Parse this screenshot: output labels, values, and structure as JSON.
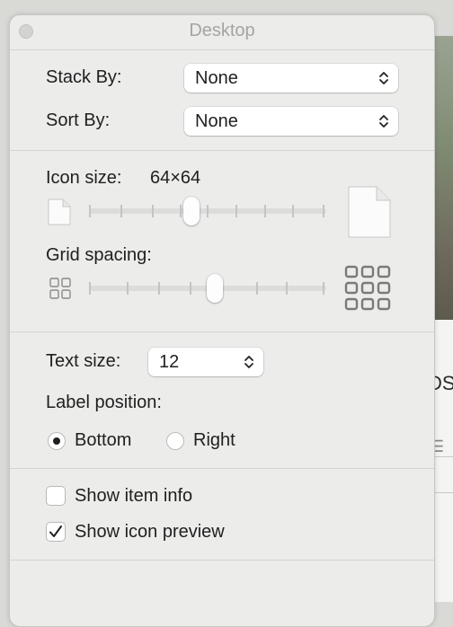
{
  "window": {
    "title": "Desktop"
  },
  "arrange": {
    "stack_by": {
      "label": "Stack By:",
      "value": "None"
    },
    "sort_by": {
      "label": "Sort By:",
      "value": "None"
    }
  },
  "icon_size": {
    "label": "Icon size:",
    "value": "64×64",
    "slider_fraction": 0.43
  },
  "grid_spacing": {
    "label": "Grid spacing:",
    "slider_fraction": 0.53
  },
  "text": {
    "label": "Text size:",
    "value": "12",
    "label_position": {
      "label": "Label position:",
      "options": [
        {
          "label": "Bottom",
          "selected": true
        },
        {
          "label": "Right",
          "selected": false
        }
      ]
    }
  },
  "options": {
    "show_item_info": {
      "label": "Show item info",
      "checked": false
    },
    "show_icon_preview": {
      "label": "Show icon preview",
      "checked": true
    }
  },
  "background": {
    "partial_text": "DS"
  }
}
